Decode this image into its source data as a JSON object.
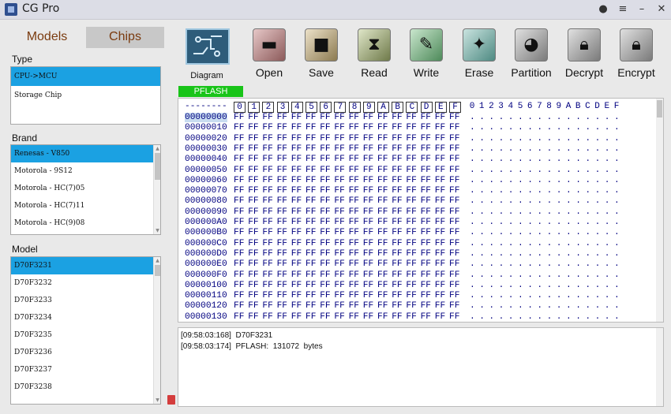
{
  "window": {
    "title": "CG Pro"
  },
  "tabs": {
    "models": "Models",
    "chips": "Chips"
  },
  "type": {
    "label": "Type",
    "items": [
      "CPU->MCU",
      "Storage Chip"
    ],
    "selected": 0
  },
  "brand": {
    "label": "Brand",
    "items": [
      "Renesas - V850",
      "Motorola - 9S12",
      "Motorola - HC(7)05",
      "Motorola - HC(7)11",
      "Motorola - HC(9)08"
    ],
    "selected": 0
  },
  "model": {
    "label": "Model",
    "items": [
      "D70F3231",
      "D70F3232",
      "D70F3233",
      "D70F3234",
      "D70F3235",
      "D70F3236",
      "D70F3237",
      "D70F3238"
    ],
    "selected": 0
  },
  "toolbar": {
    "diagram": "Diagram",
    "open": "Open",
    "save": "Save",
    "read": "Read",
    "write": "Write",
    "erase": "Erase",
    "partition": "Partition",
    "decrypt": "Decrypt",
    "encrypt": "Encrypt"
  },
  "region": {
    "label": "PFLASH"
  },
  "hex": {
    "header_dashes": "--------",
    "hex_columns": [
      "0",
      "1",
      "2",
      "3",
      "4",
      "5",
      "6",
      "7",
      "8",
      "9",
      "A",
      "B",
      "C",
      "D",
      "E",
      "F"
    ],
    "ascii_columns": [
      "0",
      "1",
      "2",
      "3",
      "4",
      "5",
      "6",
      "7",
      "8",
      "9",
      "A",
      "B",
      "C",
      "D",
      "E",
      "F"
    ],
    "rows": [
      "00000000",
      "00000010",
      "00000020",
      "00000030",
      "00000040",
      "00000050",
      "00000060",
      "00000070",
      "00000080",
      "00000090",
      "000000A0",
      "000000B0",
      "000000C0",
      "000000D0",
      "000000E0",
      "000000F0",
      "00000100",
      "00000110",
      "00000120",
      "00000130"
    ],
    "fill_byte": "FF",
    "ascii_char": ".",
    "selected_row": 0
  },
  "log": {
    "lines": [
      "[09:58:03:168]  D70F3231",
      "[09:58:03:174]  PFLASH:  131072  bytes"
    ]
  },
  "colors": {
    "selection": "#1ba1e2",
    "pflash": "#19c419",
    "hex_text": "#000080"
  }
}
